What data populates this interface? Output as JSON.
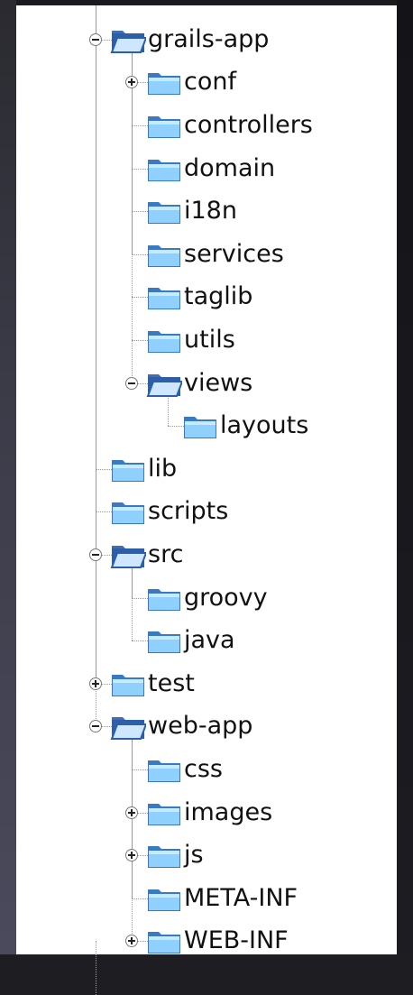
{
  "tree": {
    "nodes": [
      {
        "label": "grails-app",
        "depth": 1,
        "expanded": true
      },
      {
        "label": "conf",
        "depth": 2,
        "expanded": false
      },
      {
        "label": "controllers",
        "depth": 2,
        "expanded": null
      },
      {
        "label": "domain",
        "depth": 2,
        "expanded": null
      },
      {
        "label": "i18n",
        "depth": 2,
        "expanded": null
      },
      {
        "label": "services",
        "depth": 2,
        "expanded": null
      },
      {
        "label": "taglib",
        "depth": 2,
        "expanded": null
      },
      {
        "label": "utils",
        "depth": 2,
        "expanded": null
      },
      {
        "label": "views",
        "depth": 2,
        "expanded": true
      },
      {
        "label": "layouts",
        "depth": 3,
        "expanded": null
      },
      {
        "label": "lib",
        "depth": 1,
        "expanded": null
      },
      {
        "label": "scripts",
        "depth": 1,
        "expanded": null
      },
      {
        "label": "src",
        "depth": 1,
        "expanded": true
      },
      {
        "label": "groovy",
        "depth": 2,
        "expanded": null
      },
      {
        "label": "java",
        "depth": 2,
        "expanded": null
      },
      {
        "label": "test",
        "depth": 1,
        "expanded": false
      },
      {
        "label": "web-app",
        "depth": 1,
        "expanded": true
      },
      {
        "label": "css",
        "depth": 2,
        "expanded": null
      },
      {
        "label": "images",
        "depth": 2,
        "expanded": false
      },
      {
        "label": "js",
        "depth": 2,
        "expanded": false
      },
      {
        "label": "META-INF",
        "depth": 2,
        "expanded": null
      },
      {
        "label": "WEB-INF",
        "depth": 2,
        "expanded": false
      }
    ]
  }
}
